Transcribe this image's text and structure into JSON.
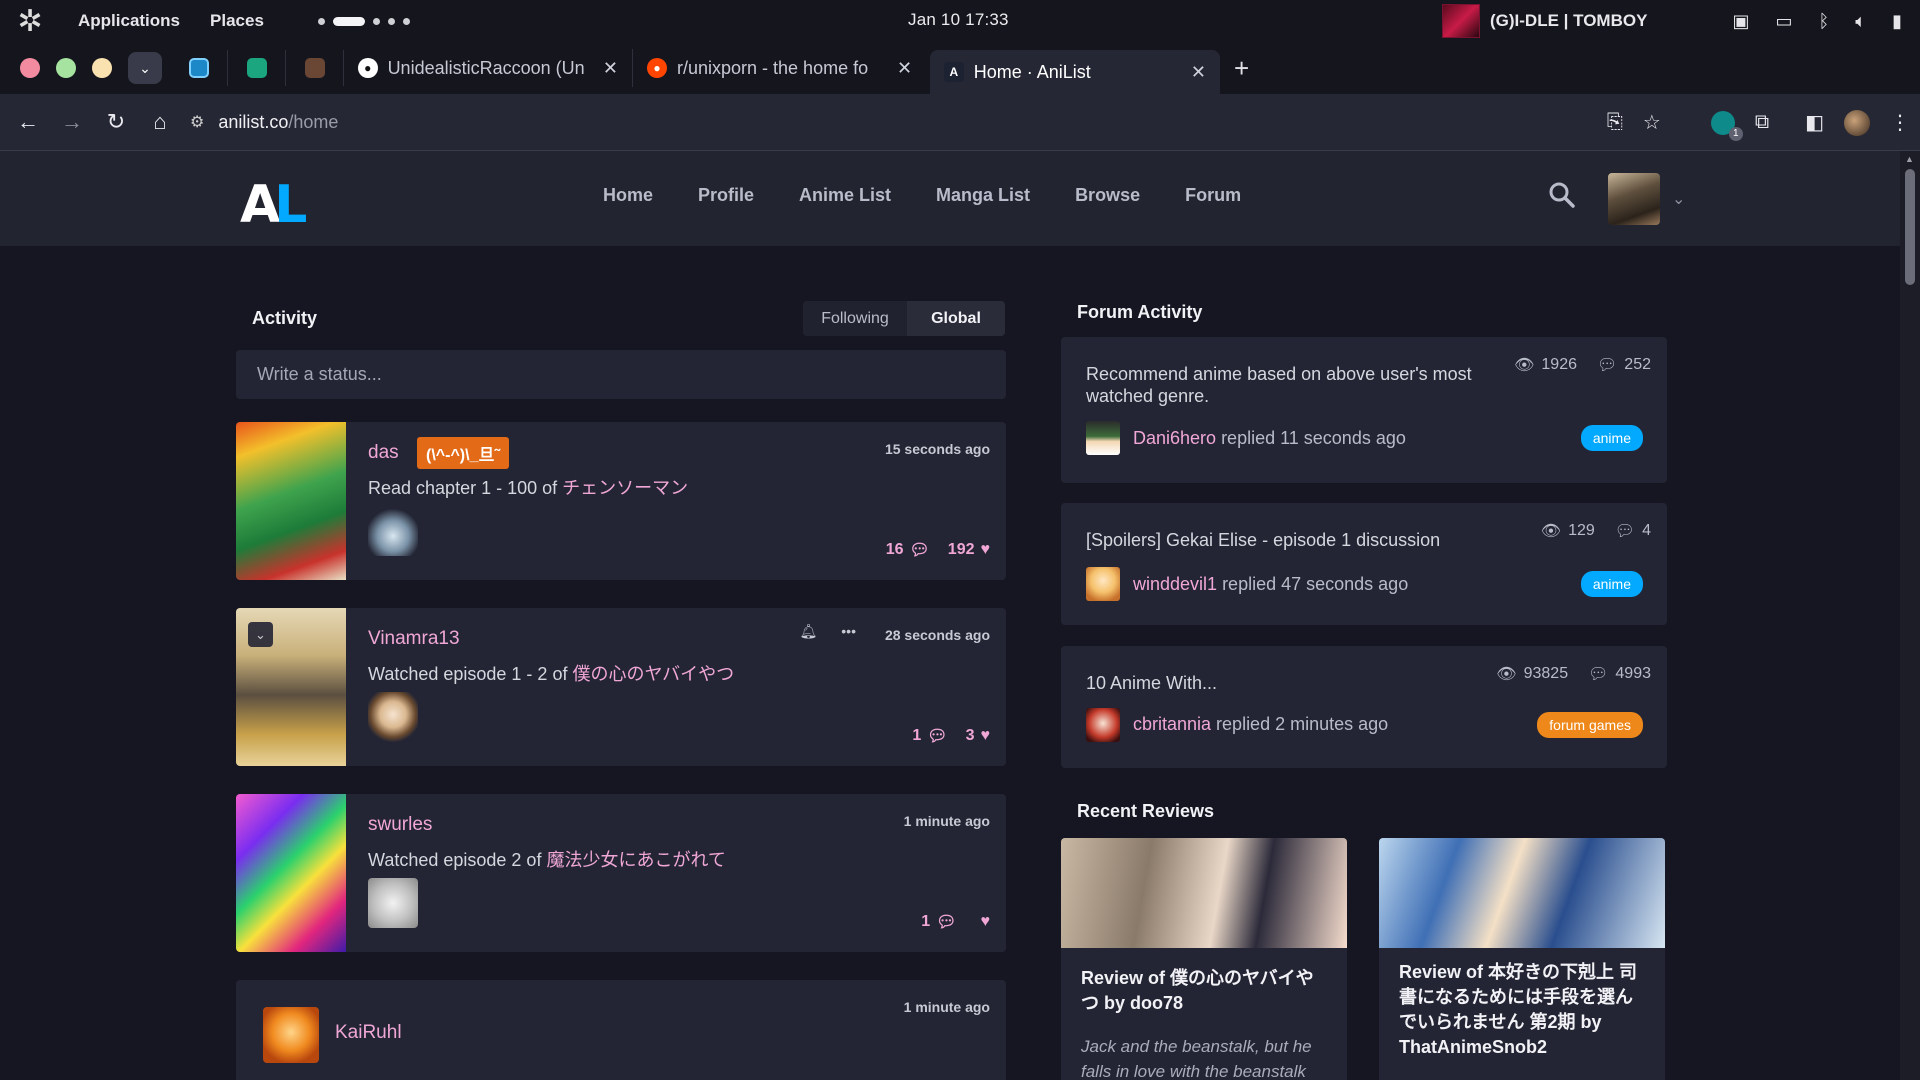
{
  "gnome": {
    "applications": "Applications",
    "places": "Places",
    "clock": "Jan 10  17:33",
    "media_title": "(G)I-DLE | TOMBOY"
  },
  "tabs": [
    {
      "title": "UnidealisticRaccoon (Un",
      "favicon": "github-icon"
    },
    {
      "title": "r/unixporn - the home fo",
      "favicon": "reddit-icon"
    },
    {
      "title": "Home · AniList",
      "favicon": "anilist-icon",
      "active": true
    }
  ],
  "toolbar": {
    "url_host": "anilist.co",
    "url_path": "/home",
    "extension_count": "1"
  },
  "site": {
    "logo_a": "A",
    "logo_l": "L",
    "nav": [
      "Home",
      "Profile",
      "Anime List",
      "Manga List",
      "Browse",
      "Forum"
    ]
  },
  "activity": {
    "title": "Activity",
    "toggle_following": "Following",
    "toggle_global": "Global",
    "status_placeholder": "Write a status...",
    "items": [
      {
        "user": "das",
        "badge": "(\\^-^)\\_旦˜",
        "action": "Read chapter 1 - 100 of ",
        "media": "チェンソーマン",
        "time": "15 seconds ago",
        "replies": "16",
        "likes": "192"
      },
      {
        "user": "Vinamra13",
        "action": "Watched episode 1 - 2 of ",
        "media": "僕の心のヤバイやつ",
        "time": "28 seconds ago",
        "replies": "1",
        "likes": "3"
      },
      {
        "user": "swurles",
        "action": "Watched episode 2 of ",
        "media": "魔法少女にあこがれて",
        "time": "1 minute ago",
        "replies": "1",
        "likes": ""
      },
      {
        "user": "KaiRuhl",
        "time": "1 minute ago"
      }
    ]
  },
  "forum": {
    "title": "Forum Activity",
    "threads": [
      {
        "title": "Recommend anime based on above user's most watched genre.",
        "views": "1926",
        "replies": "252",
        "user": "Dani6hero",
        "reply_text": " replied 11 seconds ago",
        "tag": "anime"
      },
      {
        "title": "[Spoilers] Gekai Elise - episode 1 discussion",
        "views": "129",
        "replies": "4",
        "user": "winddevil1",
        "reply_text": " replied 47 seconds ago",
        "tag": "anime"
      },
      {
        "title": "10 Anime With...",
        "views": "93825",
        "replies": "4993",
        "user": "cbritannia",
        "reply_text": " replied 2 minutes ago",
        "tag": "forum games"
      }
    ]
  },
  "reviews": {
    "title": "Recent Reviews",
    "items": [
      {
        "heading": "Review of 僕の心のヤバイやつ by doo78",
        "summary": "Jack and the beanstalk, but he falls in love with the beanstalk"
      },
      {
        "heading": "Review of 本好きの下剋上 司書になるためには手段を選んでいられません 第2期 by ThatAnimeSnob2",
        "summary": ""
      }
    ]
  },
  "colors": {
    "accent_pink": "#f0a7d6",
    "anilist_blue": "#02a9ff",
    "tag_orange": "#ef881a"
  }
}
